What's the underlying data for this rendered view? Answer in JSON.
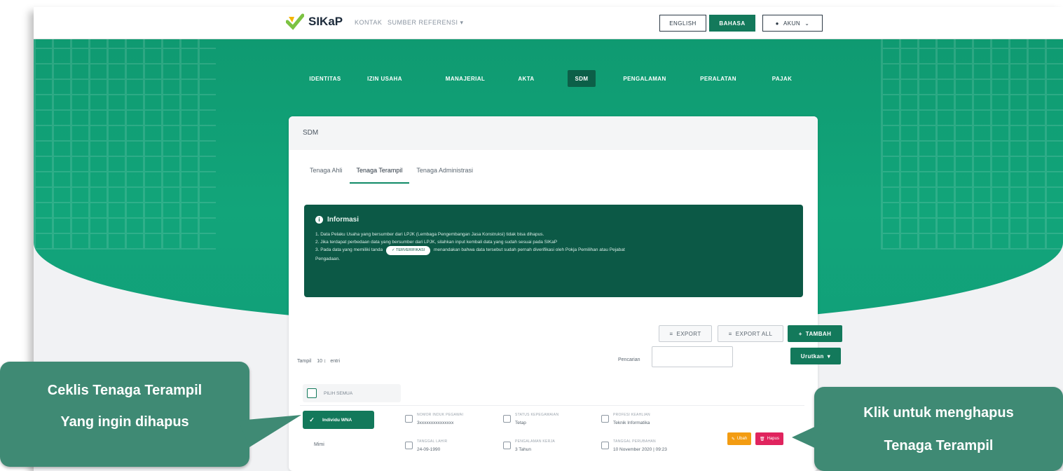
{
  "app": {
    "logo": "SIKaP",
    "nav": [
      "KONTAK",
      "SUMBER REFERENSI"
    ],
    "lang_en": "ENGLISH",
    "lang_id": "BAHASA",
    "account": "AKUN"
  },
  "menu": [
    "IDENTITAS",
    "IZIN USAHA",
    "MANAJERIAL",
    "AKTA",
    "SDM",
    "PENGALAMAN",
    "PERALATAN",
    "PAJAK"
  ],
  "card": {
    "title": "SDM",
    "tabs": [
      "Tenaga Ahli",
      "Tenaga Terampil",
      "Tenaga Administrasi"
    ],
    "active_tab": "Tenaga Terampil"
  },
  "info": {
    "title": "Informasi",
    "line1": "1. Data Pelaku Usaha yang bersumber dari LPJK (Lembaga Pengembangan Jasa Konstruksi) tidak bisa dihapus.",
    "line2": "2. Jika terdapat perbedaan data yang bersumber dari LPJK, silahkan input kembali data yang sudah sesuai pada SIKaP",
    "line3a": "3. Pada data yang memiliki tanda",
    "badge": "TERVERIFIKASI",
    "line3b": "menandakan bahwa data tersebut sudah pernah diverifikasi oleh Pokja Pemilihan atau Pejabat",
    "line4": "Pengadaan."
  },
  "toolbar": {
    "export": "EXPORT",
    "export_all": "EXPORT ALL",
    "tambah": "TAMBAH",
    "show_label": "Tampil",
    "show_value": "10",
    "show_suffix": "entri",
    "search_label": "Pencarian",
    "sort": "Urutkan"
  },
  "table": {
    "select_all": "PILIH SEMUA",
    "row_tag": "Individu WNA",
    "row_name": "Mimi",
    "fields": [
      {
        "label": "NOMOR INDUK PEGAWAI",
        "value": "3xxxxxxxxxxxxxxx"
      },
      {
        "label": "STATUS KEPEGAWAIAN",
        "value": "Tetap"
      },
      {
        "label": "PROFESI KEAHLIAN",
        "value": "Teknik Informatika"
      },
      {
        "label": "TANGGAL LAHIR",
        "value": "24-09-1990"
      },
      {
        "label": "PENGALAMAN KERJA",
        "value": "3 Tahun"
      },
      {
        "label": "TANGGAL PERUBAHAN",
        "value": "10 November 2020 | 09:23"
      }
    ],
    "edit": "Ubah",
    "delete": "Hapus"
  },
  "callouts": {
    "left_line1": "Ceklis Tenaga Terampil",
    "left_line2": "Yang ingin dihapus",
    "right_line1": "Klik untuk menghapus",
    "right_line2": "Tenaga Terampil"
  },
  "colors": {
    "brand": "#13795b",
    "hero": "#12a57a",
    "info_panel": "#0c5946",
    "edit": "#f39c12",
    "delete": "#e0245e",
    "callout": "#3f8a74"
  }
}
